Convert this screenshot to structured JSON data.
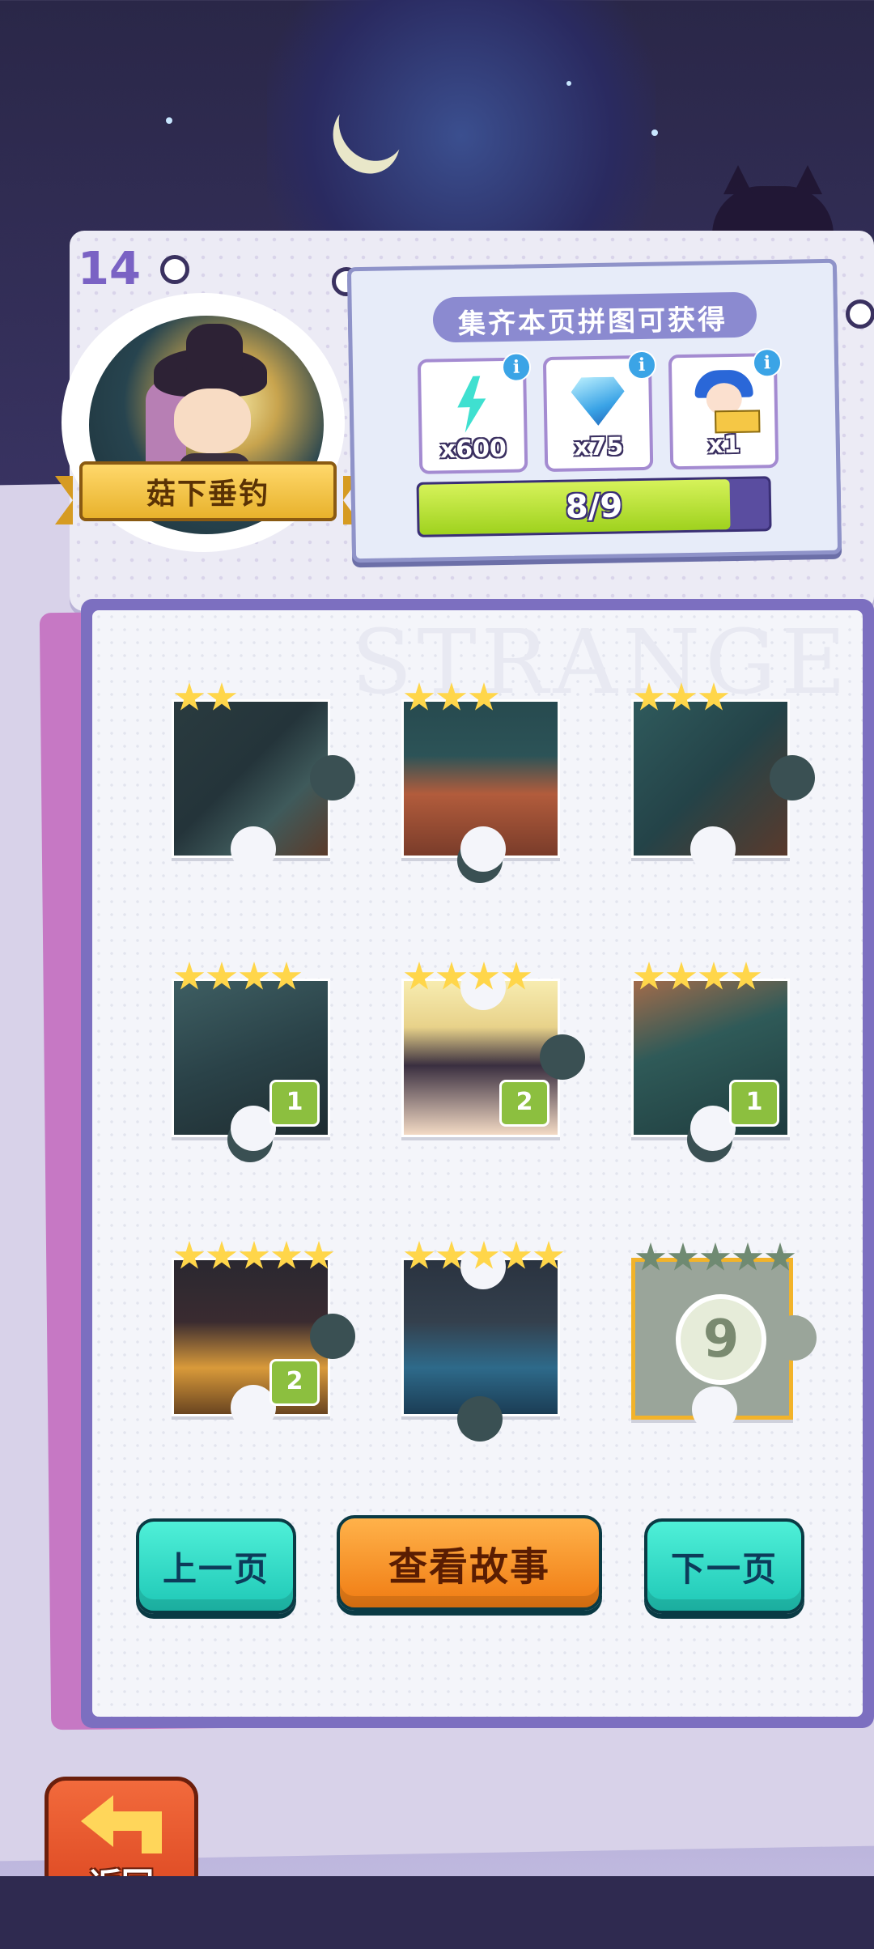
{
  "page": {
    "page_number": "14",
    "level_name": "菇下垂钓",
    "watermark": "STRANGE"
  },
  "rewards": {
    "title": "集齐本页拼图可获得",
    "items": [
      {
        "icon": "lightning-energy-icon",
        "qty": "x600"
      },
      {
        "icon": "diamond-gem-icon",
        "qty": "x75"
      },
      {
        "icon": "jester-avatar-icon",
        "qty": "x1"
      }
    ],
    "progress_text": "8/9",
    "progress_fraction": 0.889
  },
  "pieces": [
    {
      "stars": 2,
      "count": ""
    },
    {
      "stars": 3,
      "count": ""
    },
    {
      "stars": 3,
      "count": ""
    },
    {
      "stars": 4,
      "count": "1"
    },
    {
      "stars": 4,
      "count": "2"
    },
    {
      "stars": 4,
      "count": "1"
    },
    {
      "stars": 5,
      "count": "2"
    },
    {
      "stars": 5,
      "count": ""
    },
    {
      "stars": 5,
      "count": "",
      "locked_number": "9"
    }
  ],
  "buttons": {
    "prev": "上一页",
    "story": "查看故事",
    "next": "下一页",
    "back": "返回"
  },
  "colors": {
    "accent_teal": "#1ec7b6",
    "accent_orange": "#f07b12",
    "progress_green": "#9fd21e",
    "star_gold": "#ffd64a"
  }
}
